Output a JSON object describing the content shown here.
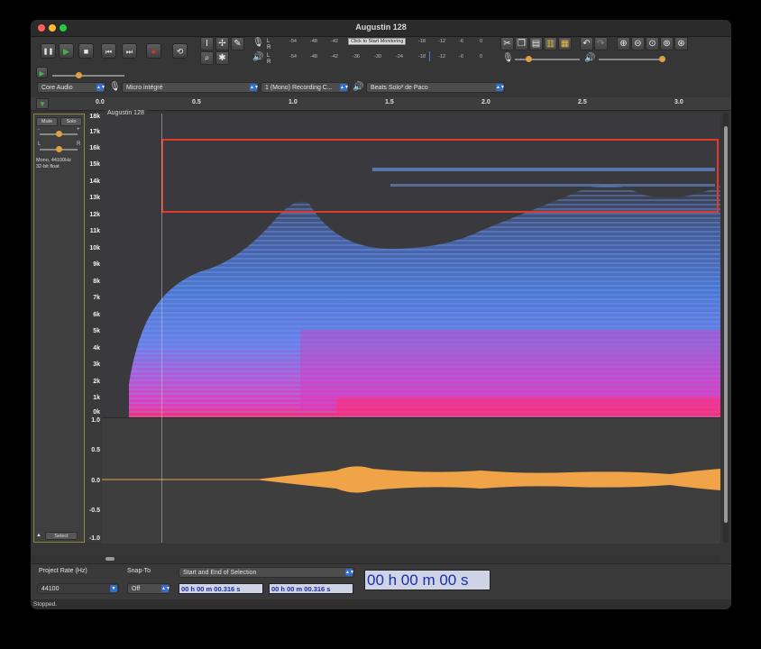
{
  "window": {
    "title": "Augustin 128"
  },
  "transport": {
    "pause": "❚❚",
    "play": "▶",
    "stop": "■",
    "skip_start": "⏮",
    "skip_end": "⏭",
    "record": "●",
    "loop": "⟲"
  },
  "meters": {
    "record_ticks": [
      "-54",
      "-48",
      "-42",
      "-18",
      "-12",
      "-6",
      "0"
    ],
    "monitor_label": "Click to Start Monitoring",
    "play_ticks": [
      "-54",
      "-48",
      "-42",
      "-36",
      "-30",
      "-24",
      "-18",
      "-12",
      "-6",
      "0"
    ],
    "channel_l": "L",
    "channel_r": "R"
  },
  "devices": {
    "host": "Core Audio",
    "input": "Micro intégré",
    "channels": "1 (Mono) Recording C...",
    "output": "Beats Solo³ de Paco"
  },
  "ruler": {
    "ticks": [
      "0.0",
      "0.5",
      "1.0",
      "1.5",
      "2.0",
      "2.5",
      "3.0"
    ]
  },
  "track": {
    "name": "Augustin 128",
    "mute": "Mute",
    "solo": "Solo",
    "gain_minus": "-",
    "gain_plus": "+",
    "pan_l": "L",
    "pan_r": "R",
    "info_line1": "Mono, 44100Hz",
    "info_line2": "32-bit float",
    "select": "Select",
    "collapse": "▲"
  },
  "spectrogram": {
    "freq_labels": [
      "18k",
      "17k",
      "16k",
      "15k",
      "14k",
      "13k",
      "12k",
      "11k",
      "10k",
      "9k",
      "8k",
      "7k",
      "6k",
      "5k",
      "4k",
      "3k",
      "2k",
      "1k",
      "0k"
    ]
  },
  "waveform": {
    "amp_labels": [
      "1.0",
      "0.5",
      "0.0",
      "-0.5",
      "-1.0"
    ],
    "color": "#f0a347"
  },
  "bottom": {
    "rate_label": "Project Rate (Hz)",
    "rate_value": "44100",
    "snap_label": "Snap-To",
    "snap_value": "Off",
    "selection_mode": "Start and End of Selection",
    "sel_start": "00 h 00 m 00.316 s",
    "sel_end": "00 h 00 m 00.316 s",
    "big_time": "00 h 00 m 00 s"
  },
  "status": {
    "text": "Stopped."
  },
  "colors": {
    "selection": "#e03a2c",
    "accent": "#2f6fd2",
    "play": "#3fb24a",
    "record": "#e03030"
  }
}
